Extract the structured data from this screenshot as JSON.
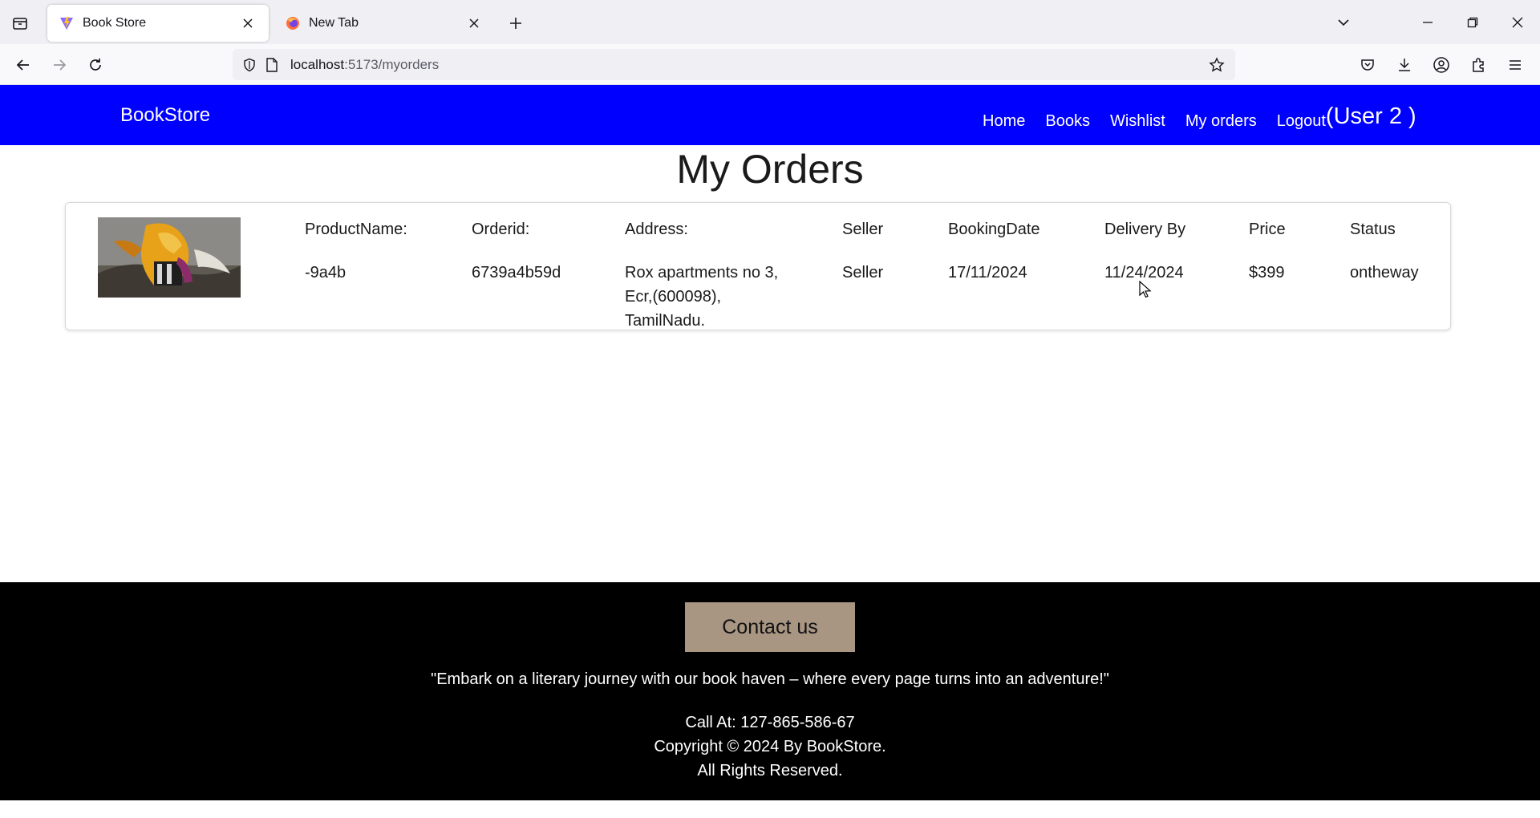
{
  "browser": {
    "tabs": [
      {
        "title": "Book Store",
        "active": true,
        "favicon": "vite-logo-icon"
      },
      {
        "title": "New Tab",
        "active": false,
        "favicon": "firefox-icon"
      }
    ],
    "url_host": "localhost",
    "url_path": ":5173/myorders"
  },
  "header": {
    "brand": "BookStore",
    "nav": {
      "home": "Home",
      "books": "Books",
      "wishlist": "Wishlist",
      "my_orders": "My orders",
      "logout": "Logout"
    },
    "user": "(User 2 )"
  },
  "page": {
    "title": "My Orders"
  },
  "order": {
    "labels": {
      "product_name": "ProductName:",
      "order_id": "Orderid:",
      "address": "Address:",
      "seller": "Seller",
      "booking_date": "BookingDate",
      "delivery_by": "Delivery By",
      "price": "Price",
      "status": "Status"
    },
    "values": {
      "product_name": "-9a4b",
      "order_id": "6739a4b59d",
      "address_line1": "Rox apartments no 3,",
      "address_line2": "Ecr,(600098),",
      "address_line3": "TamilNadu.",
      "seller": "Seller",
      "booking_date": "17/11/2024",
      "delivery_by": "11/24/2024",
      "price": "$399",
      "status": "ontheway"
    }
  },
  "footer": {
    "contact_button": "Contact us",
    "tagline": "\"Embark on a literary journey with our book haven – where every page turns into an adventure!\"",
    "call": "Call At: 127-865-586-67",
    "copyright": "Copyright © 2024 By BookStore.",
    "rights": "All Rights Reserved."
  },
  "colors": {
    "header_bg": "#0000ff",
    "footer_bg": "#000000",
    "contact_button_bg": "#a89582"
  }
}
